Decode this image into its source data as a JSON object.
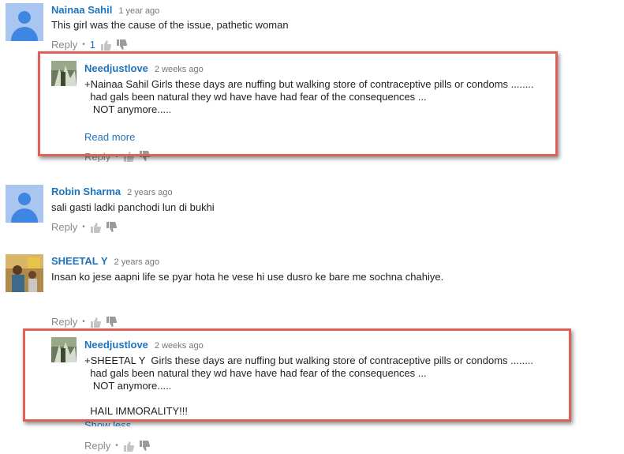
{
  "comments": [
    {
      "author": "Nainaa Sahil",
      "time": "1 year ago",
      "text": "This girl was the cause of the issue, pathetic woman",
      "reply_label": "Reply",
      "likes": "1"
    },
    {
      "author": "Robin Sharma",
      "time": "2 years ago",
      "text": "sali gasti ladki panchodi lun di bukhi",
      "reply_label": "Reply"
    },
    {
      "author": "SHEETAL Y",
      "time": "2 years ago",
      "text": "Insan ko jese aapni life se pyar hota he vese hi use dusro ke bare me sochna chahiye.",
      "reply_label": "Reply"
    }
  ],
  "replies": [
    {
      "author": "Needjustlove",
      "time": "2 weeks ago",
      "lines": [
        "+Nainaa Sahil Girls these days are nuffing but walking store of contraceptive pills or condoms ........",
        "  had gals been natural they wd have have had fear of the consequences ...",
        "   NOT anymore....."
      ],
      "link_label": "Read more",
      "reply_label": "Reply"
    },
    {
      "author": "Needjustlove",
      "time": "2 weeks ago",
      "lines": [
        "+SHEETAL Y  Girls these days are nuffing but walking store of contraceptive pills or condoms ........",
        "  had gals been natural they wd have have had fear of the consequences ...",
        "   NOT anymore.....",
        "",
        "  HAIL IMMORALITY!!!"
      ],
      "link_label": "Show less",
      "reply_label": "Reply"
    }
  ],
  "icons": {
    "like": "thumbs-up-icon",
    "dislike": "thumbs-down-icon"
  },
  "colors": {
    "link": "#1e73be",
    "highlight_box": "#e0605a"
  }
}
